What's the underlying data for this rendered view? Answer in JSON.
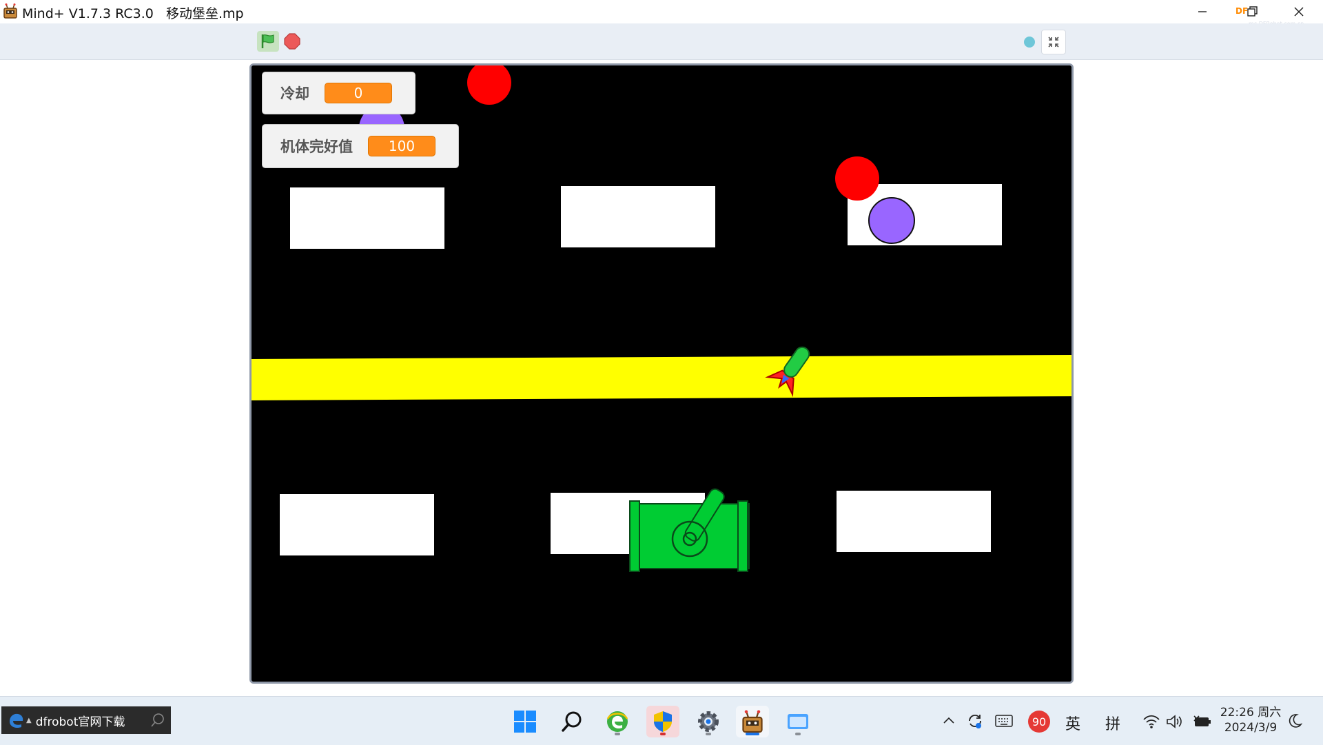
{
  "window": {
    "title": "Mind+ V1.7.3 RC3.0   移动堡垒.mp",
    "brand_logo": "DF",
    "brand_sub": "mc.DFRobot.com.cn"
  },
  "toolbar": {
    "start_icon": "green-flag-icon",
    "stop_icon": "stop-sign-icon",
    "fullscreen_icon": "exit-fullscreen-icon"
  },
  "stage": {
    "background": "#000000",
    "monitors": [
      {
        "label": "冷却",
        "value": "0"
      },
      {
        "label": "机体完好值",
        "value": "100"
      }
    ],
    "road_color": "#ffff00",
    "block_color": "#ffffff",
    "tank_color": "#00cc33",
    "enemy_red": "#ff0000",
    "enemy_purple": "#9966ff"
  },
  "taskbar": {
    "search_text": "dfrobot官网下载",
    "badge_count": "90",
    "ime_lang": "英",
    "ime_mode": "拼",
    "time": "22:26 周六",
    "date": "2024/3/9"
  }
}
